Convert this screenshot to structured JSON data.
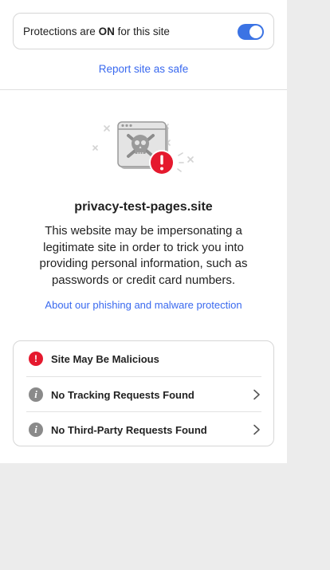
{
  "protections": {
    "prefix": "Protections are",
    "state": "ON",
    "suffix": "for this site",
    "toggle_on": true
  },
  "report_link": "Report site as safe",
  "site": {
    "name": "privacy-test-pages.site",
    "warning": "This website may be impersonating a legitimate site in order to trick you into providing personal information, such as passwords or credit card numbers.",
    "about_link": "About our phishing and malware protection"
  },
  "status_items": [
    {
      "label": "Site May Be Malicious",
      "icon": "alert-icon",
      "chevron": false
    },
    {
      "label": "No Tracking Requests Found",
      "icon": "info-icon",
      "chevron": true
    },
    {
      "label": "No Third-Party Requests Found",
      "icon": "info-icon",
      "chevron": true
    }
  ],
  "colors": {
    "accent": "#3969ef",
    "toggle": "#3b73e4",
    "alert": "#e5192e",
    "info": "#8a8a8a",
    "background": "#ececec"
  }
}
